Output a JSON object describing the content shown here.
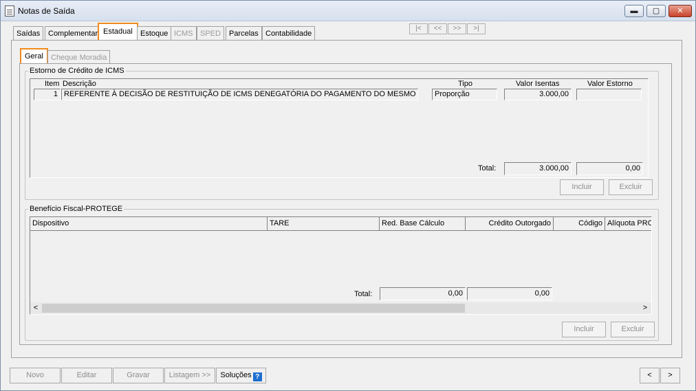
{
  "window": {
    "title": "Notas de Saída",
    "minimize": "▬",
    "maximize": "▢",
    "close": "✕"
  },
  "main_tabs": [
    {
      "label": "Saídas"
    },
    {
      "label": "Complementar"
    },
    {
      "label": "Estadual"
    },
    {
      "label": "Estoque"
    },
    {
      "label": "ICMS"
    },
    {
      "label": "SPED"
    },
    {
      "label": "Parcelas"
    },
    {
      "label": "Contabilidade"
    }
  ],
  "record_nav": {
    "first": "|<",
    "prev": "<<",
    "next": ">>",
    "last": ">|"
  },
  "sub_tabs": [
    {
      "label": "Geral"
    },
    {
      "label": "Cheque Moradia"
    }
  ],
  "estorno": {
    "title": "Estorno de Crédito de ICMS",
    "headers": {
      "item": "Item",
      "descricao": "Descrição",
      "tipo": "Tipo",
      "valor_isentas": "Valor Isentas",
      "valor_estorno": "Valor Estorno"
    },
    "row": {
      "item": "1",
      "descricao": "REFERENTE À DECISÃO DE RESTITUIÇÃO DE ICMS DENEGATÓRIA DO PAGAMENTO DO MESMO RE",
      "tipo": "Proporção",
      "valor_isentas": "3.000,00",
      "valor_estorno": ""
    },
    "total_label": "Total:",
    "total_isentas": "3.000,00",
    "total_estorno": "0,00",
    "incluir": "Incluir",
    "excluir": "Excluir"
  },
  "beneficio": {
    "title": "Benefício Fiscal-PROTEGE",
    "headers": {
      "dispositivo": "Dispositivo",
      "tare": "TARE",
      "red_base": "Red. Base Cálculo",
      "credito": "Crédito Outorgado",
      "codigo": "Código",
      "aliquota": "Alíquota PRO"
    },
    "total_label": "Total:",
    "total_red_base": "0,00",
    "total_credito": "0,00",
    "scroll_left": "<",
    "scroll_right": ">",
    "incluir": "Incluir",
    "excluir": "Excluir"
  },
  "bottom": {
    "novo": "Novo",
    "editar": "Editar",
    "gravar": "Gravar",
    "listagem": "Listagem >>",
    "solucoes": "Soluções",
    "help": "?",
    "prev": "<",
    "next": ">"
  }
}
